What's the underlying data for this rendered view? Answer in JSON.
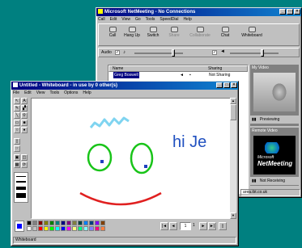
{
  "netmeeting": {
    "title": "Microsoft NetMeeting - No Connections",
    "menu": [
      "Call",
      "Edit",
      "View",
      "Go",
      "Tools",
      "SpeedDial",
      "Help"
    ],
    "toolbar": [
      "Call",
      "Hang Up",
      "Switch",
      "Share",
      "Collaborate",
      "Chat",
      "Whiteboard"
    ],
    "audio_label": "Audio",
    "list_headers": [
      "Name",
      "Sharing"
    ],
    "list_row": {
      "name": "Greg Boswell",
      "sharing": "Not Sharing"
    },
    "my_video": {
      "title": "My Video",
      "status": "Previewing"
    },
    "remote_video": {
      "title": "Remote Video",
      "status": "Not Receiving",
      "logo_line1": "Microsoft",
      "logo_line2": "NetMeeting"
    },
    "status_right": "area.ibt.co.uk"
  },
  "whiteboard": {
    "title": "Untitled - Whiteboard - in use by 0 other(s)",
    "menu": [
      "File",
      "Edit",
      "View",
      "Tools",
      "Options",
      "Help"
    ],
    "text_on_canvas": "hi Je",
    "page_indicator": "1",
    "page_total": "1",
    "status": "Whiteboard"
  },
  "colors": {
    "accent_titlebar": "#000080",
    "desktop": "#008080",
    "palette": [
      "#000000",
      "#808080",
      "#800000",
      "#808000",
      "#008000",
      "#008080",
      "#000080",
      "#800080",
      "#808040",
      "#004040",
      "#0080ff",
      "#004080",
      "#8000ff",
      "#804000",
      "#ffffff",
      "#c0c0c0",
      "#ff0000",
      "#ffff00",
      "#00ff00",
      "#00ffff",
      "#0000ff",
      "#ff00ff",
      "#ffff80",
      "#00ff80",
      "#80ffff",
      "#8080ff",
      "#ff0080",
      "#ff8040"
    ]
  }
}
